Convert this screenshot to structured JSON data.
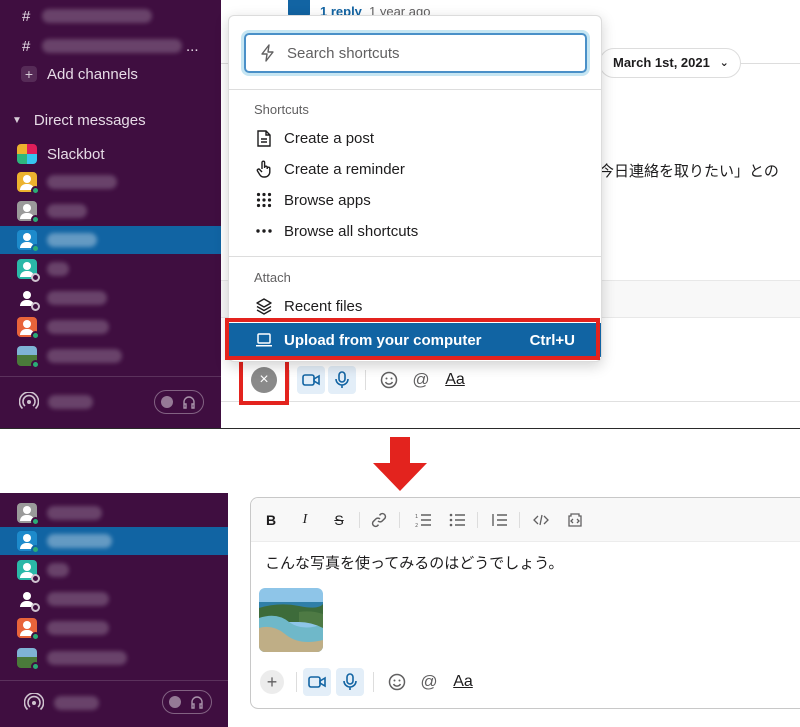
{
  "top_panel": {
    "sidebar": {
      "channel_prefix": "#",
      "add_channels_label": "Add channels",
      "direct_messages_label": "Direct messages",
      "slackbot_label": "Slackbot"
    },
    "thread": {
      "reply_link": "1 reply",
      "reply_time": "1 year ago"
    },
    "date_pill": "March 1st, 2021",
    "message_fragment": "今日連絡を取りたい」との",
    "shortcuts_popup": {
      "search_placeholder": "Search shortcuts",
      "shortcuts_section_label": "Shortcuts",
      "shortcuts": [
        {
          "label": "Create a post",
          "icon": "document-icon"
        },
        {
          "label": "Create a reminder",
          "icon": "hand-icon"
        },
        {
          "label": "Browse apps",
          "icon": "grid-icon"
        },
        {
          "label": "Browse all shortcuts",
          "icon": "ellipsis-icon"
        }
      ],
      "attach_section_label": "Attach",
      "attach_items": [
        {
          "label": "Recent files",
          "icon": "layers-icon"
        },
        {
          "label": "Upload from your computer",
          "icon": "laptop-icon",
          "shortcut": "Ctrl+U",
          "highlighted": true
        }
      ]
    },
    "composer_toolbar": {
      "close_symbol": "×",
      "format_label": "Aa"
    }
  },
  "bottom_panel": {
    "composer": {
      "formatting": [
        "B",
        "I",
        "S",
        "link",
        "ordered-list",
        "bulleted-list",
        "blockquote",
        "code",
        "code-block"
      ],
      "message_text": "こんな写真を使ってみるのはどうでしょう。",
      "plus_symbol": "+",
      "format_label": "Aa"
    }
  },
  "colors": {
    "sidebar_bg": "#3f0e40",
    "active_item": "#1164a3",
    "highlight_red": "#e3231e",
    "link_blue": "#1264a3"
  }
}
